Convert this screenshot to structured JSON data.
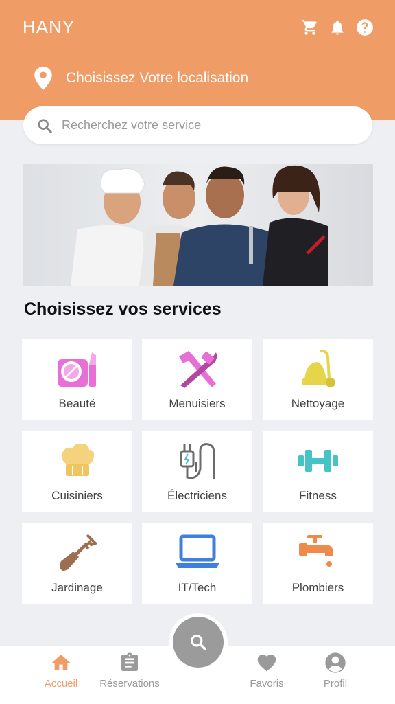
{
  "app": {
    "title": "HANY"
  },
  "header": {
    "icons": [
      "cart-icon",
      "bell-icon",
      "help-icon"
    ],
    "location_label": "Choisissez Votre localisation",
    "bg_color": "#ef9c66"
  },
  "search": {
    "placeholder": "Recherchez votre service"
  },
  "banner": {
    "icon": "service-workers-photo"
  },
  "services": {
    "title": "Choisissez vos services",
    "items": [
      {
        "label": "Beauté",
        "icon": "makeup-icon",
        "color": "#e86fd6"
      },
      {
        "label": "Menuisiers",
        "icon": "tools-icon",
        "color": "#e86fd6"
      },
      {
        "label": "Nettoyage",
        "icon": "vacuum-icon",
        "color": "#e6d54a"
      },
      {
        "label": "Cuisiniers",
        "icon": "chef-hat-icon",
        "color": "#f5d27d"
      },
      {
        "label": "Électriciens",
        "icon": "plug-icon",
        "color": "#6b6b6b"
      },
      {
        "label": "Fitness",
        "icon": "dumbbell-icon",
        "color": "#45c3c6"
      },
      {
        "label": "Jardinage",
        "icon": "shovel-icon",
        "color": "#9c6f52"
      },
      {
        "label": "IT/Tech",
        "icon": "laptop-icon",
        "color": "#3f7fdd"
      },
      {
        "label": "Plombiers",
        "icon": "faucet-icon",
        "color": "#f08a4b"
      }
    ]
  },
  "nav": {
    "items": [
      {
        "label": "Accueil",
        "icon": "home-icon",
        "active": true
      },
      {
        "label": "Réservations",
        "icon": "clipboard-icon",
        "active": false
      },
      {
        "label": "Favoris",
        "icon": "heart-icon",
        "active": false
      },
      {
        "label": "Profil",
        "icon": "user-icon",
        "active": false
      }
    ],
    "fab_icon": "search-icon",
    "active_color": "#ef9c66",
    "inactive_color": "#9a9a9a"
  }
}
